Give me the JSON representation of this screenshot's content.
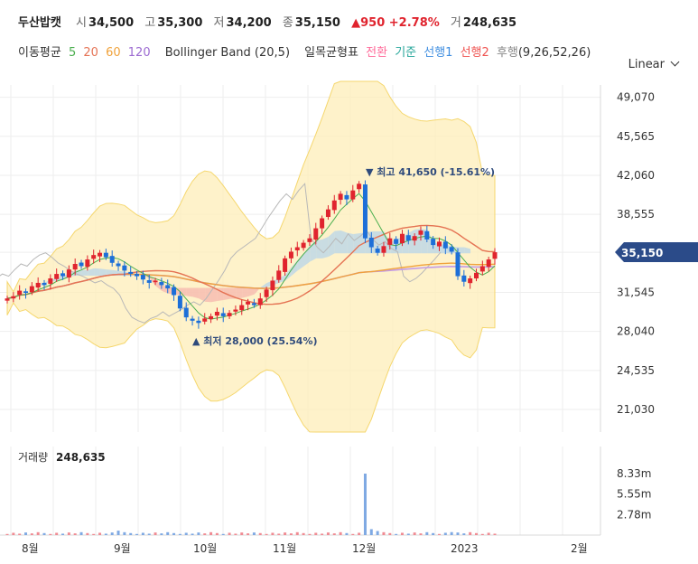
{
  "header": {
    "name": "두산밥캣",
    "open_label": "시",
    "open": "34,500",
    "high_label": "고",
    "high": "35,300",
    "low_label": "저",
    "low": "34,200",
    "close_label": "종",
    "close": "35,150",
    "change": "▲950 +2.78%",
    "volume_label": "거",
    "volume": "248,635"
  },
  "indicators": {
    "ma_label": "이동평균",
    "ma5": "5",
    "ma20": "20",
    "ma60": "60",
    "ma120": "120",
    "bb": "Bollinger Band (20,5)",
    "ichimoku_label": "일목균형표",
    "tenkan": "전환",
    "kijun": "기준",
    "span1": "선행1",
    "span2": "선행2",
    "chikou": "후행",
    "ichimoku_params": "(9,26,52,26)"
  },
  "scale_selector": "Linear",
  "colors": {
    "up": "#e0242e",
    "down": "#1d6fd8",
    "ma5": "#4caf50",
    "ma20": "#e57355",
    "ma60": "#f0a23b",
    "ma120": "#9c6bd1",
    "bb_fill": "#fdeeb8",
    "bb_line": "#f5d76e",
    "kumo_red": "#f6b6ad",
    "kumo_blue": "#b7d4ea",
    "price_tag": "#2b4b89"
  },
  "chart_data": {
    "type": "candlestick",
    "x_labels": [
      "8월",
      "9월",
      "10월",
      "11월",
      "12월",
      "2023",
      "2월"
    ],
    "y_ticks": [
      49070,
      45565,
      42060,
      38555,
      35150,
      31545,
      28040,
      24535,
      21030
    ],
    "y_tick_labels": [
      "49,070",
      "45,565",
      "42,060",
      "38,555",
      "35,150",
      "31,545",
      "28,040",
      "24,535",
      "21,030"
    ],
    "ylim": [
      19000,
      50500
    ],
    "current_price": "35,150",
    "annotations": {
      "high": "▼ 최고 41,650 (-15.61%)",
      "low": "▲ 최저 28,000 (25.54%)"
    },
    "closes": [
      31000,
      31200,
      31700,
      31500,
      32100,
      32400,
      32200,
      32800,
      33200,
      33000,
      33600,
      34100,
      33900,
      34500,
      34900,
      35100,
      34700,
      34200,
      33900,
      33500,
      33200,
      33000,
      32700,
      32400,
      32600,
      32200,
      31900,
      31300,
      30100,
      29300,
      29000,
      28800,
      29200,
      29400,
      29800,
      29400,
      29700,
      30000,
      30400,
      30700,
      30400,
      31000,
      31800,
      32600,
      33500,
      34600,
      35200,
      35600,
      36000,
      36400,
      37300,
      38200,
      39000,
      39800,
      40400,
      39900,
      40700,
      41300,
      36400,
      35600,
      35100,
      35700,
      36400,
      35900,
      36800,
      36200,
      36600,
      37100,
      36300,
      35800,
      36100,
      35500,
      35200,
      33000,
      32500,
      32800,
      33300,
      33900,
      34500,
      35150
    ],
    "volume": {
      "label": "거래량",
      "value": "248,635",
      "y_ticks": [
        "8.33m",
        "5.55m",
        "2.78m"
      ],
      "spike": "8.33m"
    }
  }
}
